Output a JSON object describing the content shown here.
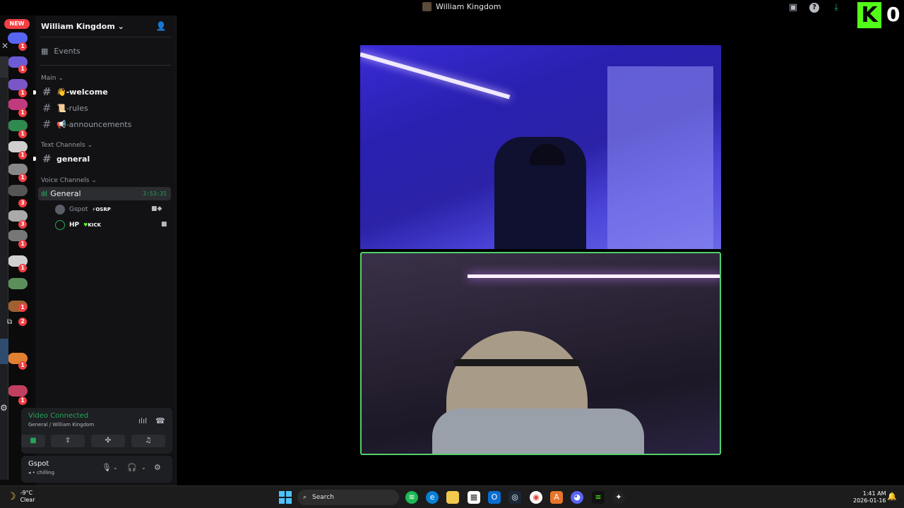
{
  "window": {
    "title": "William Kingdom"
  },
  "kick": {
    "logo_letter": "K",
    "count": "0"
  },
  "rail": {
    "new_badge": "NEW",
    "badges": [
      "1",
      "1",
      "1",
      "1",
      "1",
      "1",
      "1",
      "3",
      "3",
      "1",
      "1",
      "1",
      "2",
      "1",
      "1"
    ]
  },
  "sidebar": {
    "server_name": "William Kingdom",
    "events_label": "Events",
    "categories": {
      "main": "Main",
      "text": "Text Channels",
      "voice": "Voice Channels"
    },
    "channels": [
      {
        "emoji": "👋",
        "name": "-welcome"
      },
      {
        "emoji": "📜",
        "name": "-rules"
      },
      {
        "emoji": "📢",
        "name": "-announcements"
      },
      {
        "emoji": "",
        "name": "general"
      }
    ],
    "voice_channel": {
      "name": "General",
      "timer": "3:53:31"
    },
    "members": [
      {
        "name": "Gspot",
        "tag": "OSRP"
      },
      {
        "name": "HP",
        "tag": "KICK"
      }
    ]
  },
  "voice_panel": {
    "status": "Video Connected",
    "location": "General / William Kingdom"
  },
  "user_panel": {
    "name": "Gspot",
    "status": "chilling"
  },
  "taskbar": {
    "weather_temp": "-9°C",
    "weather_desc": "Clear",
    "search_label": "Search",
    "time": "1:41 AM",
    "date": "2026-01-16"
  },
  "colors": {
    "accent_green": "#23a55a",
    "kick_green": "#53fc18",
    "badge_red": "#f23f43",
    "video_border": "#4fd16b"
  },
  "icons": [
    "search-icon",
    "gear-icon",
    "headphones-icon",
    "microphone-icon",
    "camera-icon",
    "screen-share-icon",
    "activities-icon",
    "soundboard-icon",
    "disconnect-icon",
    "inbox-icon",
    "help-icon",
    "download-icon",
    "add-member-icon",
    "calendar-icon",
    "close-icon",
    "windows-start-icon"
  ]
}
